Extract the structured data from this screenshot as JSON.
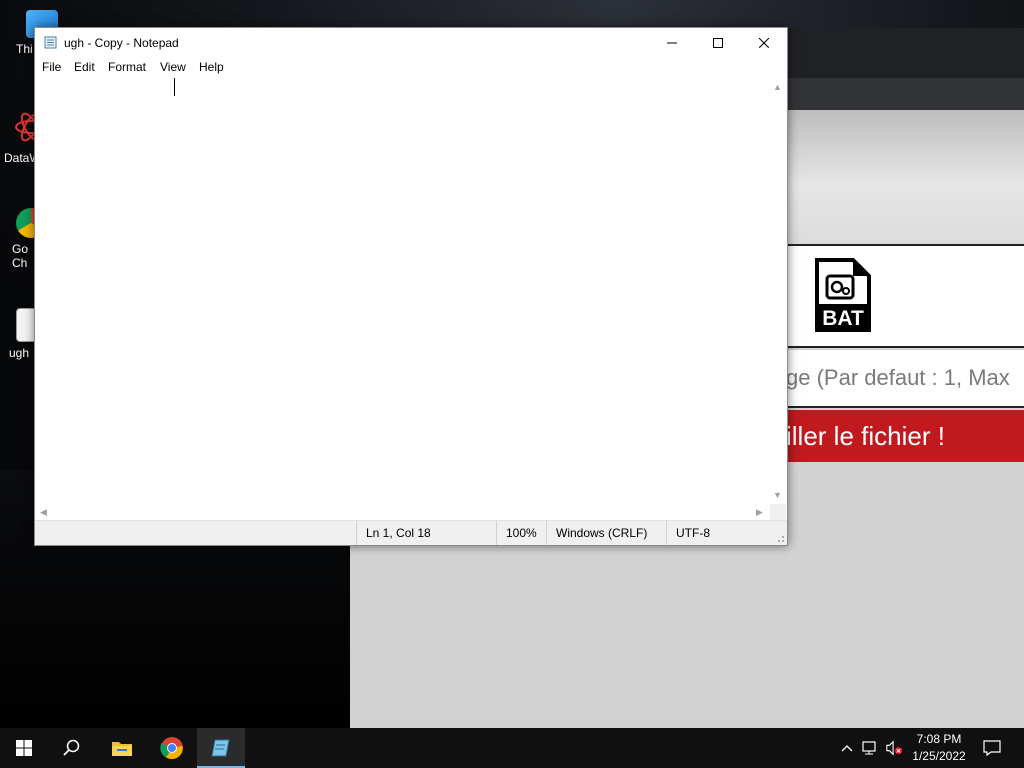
{
  "desktop": {
    "icons": [
      {
        "label": "Thi",
        "icon": "this-pc-icon"
      },
      {
        "label": "DataW",
        "icon": "datawrapper-icon"
      },
      {
        "label": "Go\nCh",
        "icon": "chrome-icon"
      },
      {
        "label": "ugh",
        "icon": "file-icon"
      }
    ]
  },
  "browser": {
    "bat_label": "BAT",
    "param_text": "ge (Par defaut : 1, Max",
    "compile_text": "iller le fichier !",
    "accent": "#c0191e"
  },
  "notepad": {
    "title": "ugh - Copy - Notepad",
    "menu": [
      "File",
      "Edit",
      "Format",
      "View",
      "Help"
    ],
    "content": "",
    "status": {
      "position": "Ln 1, Col 18",
      "zoom": "100%",
      "line_endings": "Windows (CRLF)",
      "encoding": "UTF-8"
    }
  },
  "taskbar": {
    "apps": [
      "start-icon",
      "search-icon",
      "file-explorer-icon",
      "chrome-icon",
      "notepad-icon"
    ],
    "clock": {
      "time": "7:08 PM",
      "date": "1/25/2022"
    }
  }
}
